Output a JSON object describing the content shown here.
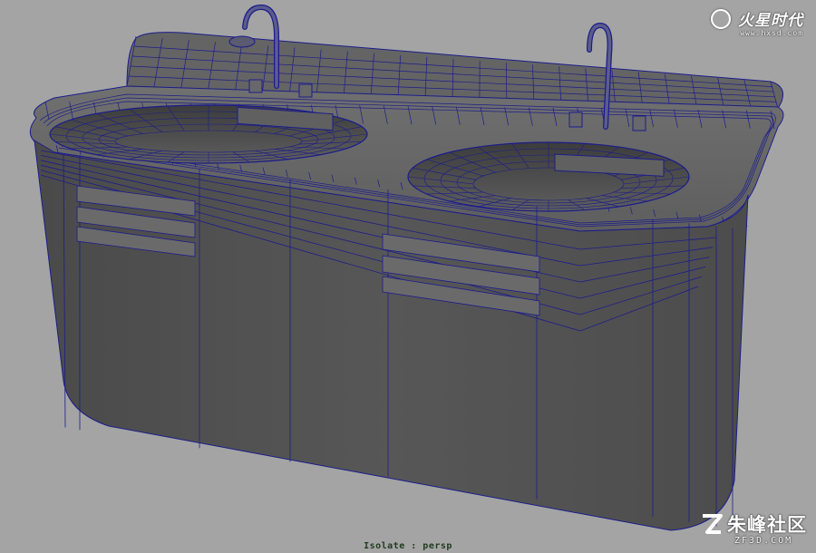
{
  "viewport": {
    "hud_label": "Isolate : persp",
    "background_color": "#a4a4a4",
    "mesh_fill_color": "#5a5a5a",
    "wire_color": "#1c1c8c"
  },
  "watermark_top": {
    "title": "火星时代",
    "url": "www.hxsd.com",
    "icon": "swirl-logo-icon"
  },
  "watermark_bottom": {
    "title": "朱峰社区",
    "url": "ZF3D.COM",
    "icon": "z-logo-icon"
  }
}
